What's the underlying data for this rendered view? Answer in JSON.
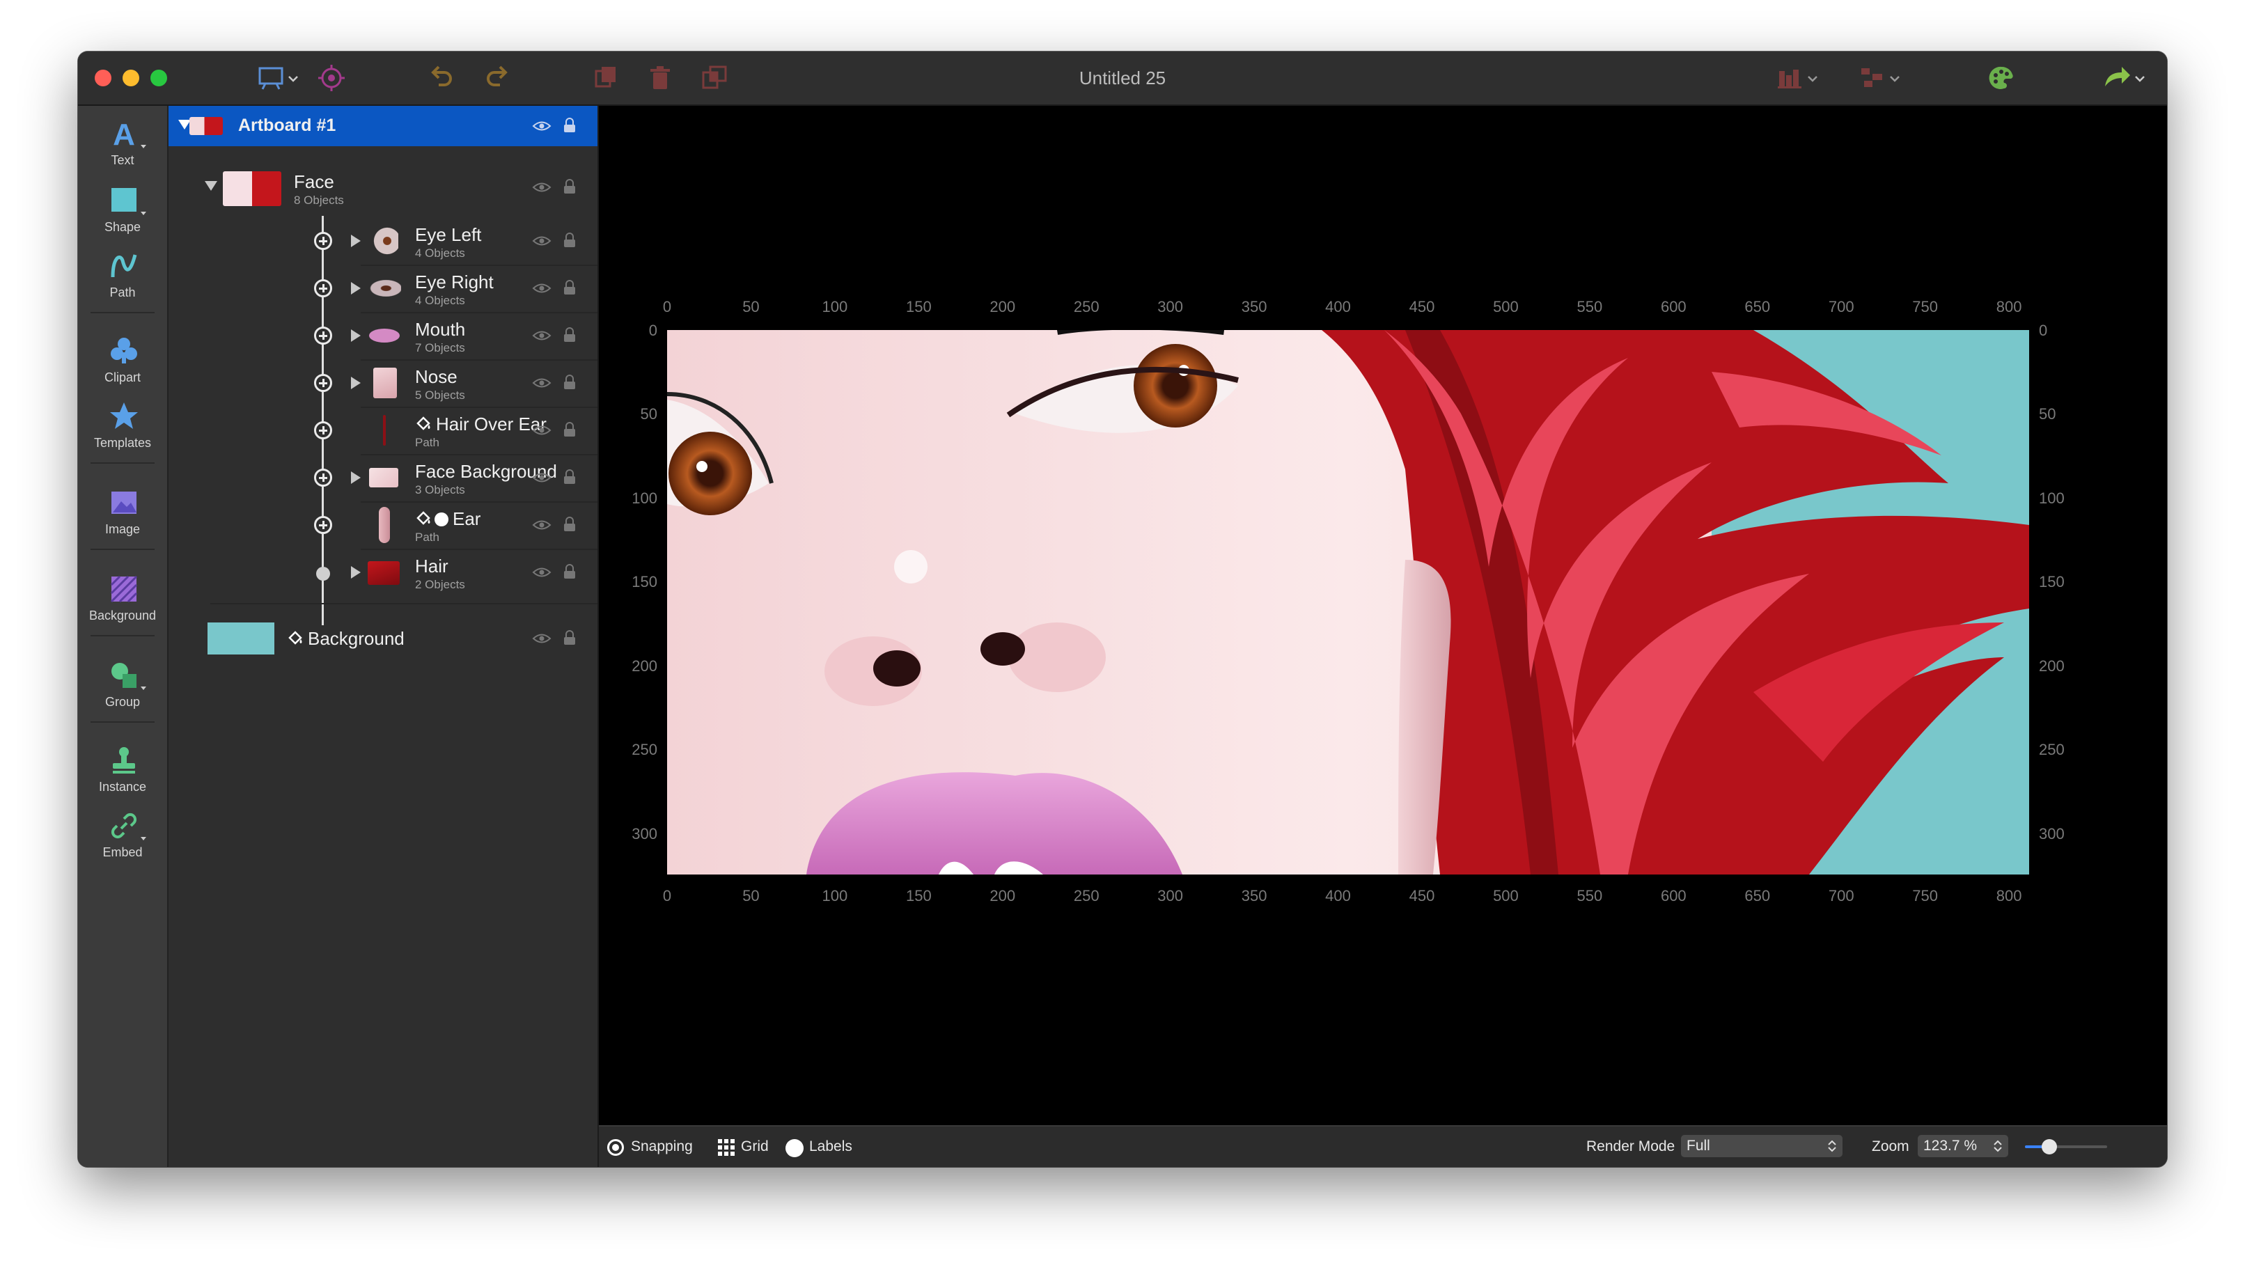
{
  "window": {
    "title": "Untitled 25"
  },
  "toolbar": {
    "icons": [
      "artboard-icon",
      "target-icon",
      "undo-icon",
      "redo-icon",
      "duplicate-icon",
      "trash-icon",
      "combine-icon",
      "chart-icon",
      "layout-icon",
      "palette-icon",
      "share-icon"
    ]
  },
  "tools": [
    {
      "label": "Text"
    },
    {
      "label": "Shape"
    },
    {
      "label": "Path"
    },
    {
      "label": "Clipart"
    },
    {
      "label": "Templates"
    },
    {
      "label": "Image"
    },
    {
      "label": "Background"
    },
    {
      "label": "Group"
    },
    {
      "label": "Instance"
    },
    {
      "label": "Embed"
    }
  ],
  "layers": {
    "artboard": {
      "name": "Artboard #1"
    },
    "face": {
      "name": "Face",
      "sub": "8 Objects"
    },
    "children": [
      {
        "name": "Eye Left",
        "sub": "4 Objects"
      },
      {
        "name": "Eye Right",
        "sub": "4 Objects"
      },
      {
        "name": "Mouth",
        "sub": "7 Objects"
      },
      {
        "name": "Nose",
        "sub": "5 Objects"
      },
      {
        "name": "Hair Over Ear",
        "sub": "Path"
      },
      {
        "name": "Face Background",
        "sub": "3 Objects"
      },
      {
        "name": "Ear",
        "sub": "Path"
      },
      {
        "name": "Hair",
        "sub": "2 Objects"
      }
    ],
    "background": {
      "name": "Background",
      "color": "#79c7cb"
    }
  },
  "rulers": {
    "x": [
      "0",
      "50",
      "100",
      "150",
      "200",
      "250",
      "300",
      "350",
      "400",
      "450",
      "500",
      "550",
      "600",
      "650",
      "700",
      "750",
      "800"
    ],
    "y": [
      "0",
      "50",
      "100",
      "150",
      "200",
      "250",
      "300"
    ]
  },
  "statusbar": {
    "snapping": "Snapping",
    "grid": "Grid",
    "labels": "Labels",
    "render_mode_label": "Render Mode",
    "render_mode_value": "Full",
    "zoom_label": "Zoom",
    "zoom_value": "123.7 %",
    "zoom_slider": 0.3
  },
  "colors": {
    "accent": "#0b57c2",
    "hair": "#b5121b",
    "hair_light": "#e8465a",
    "bg_teal": "#79c7cb"
  }
}
